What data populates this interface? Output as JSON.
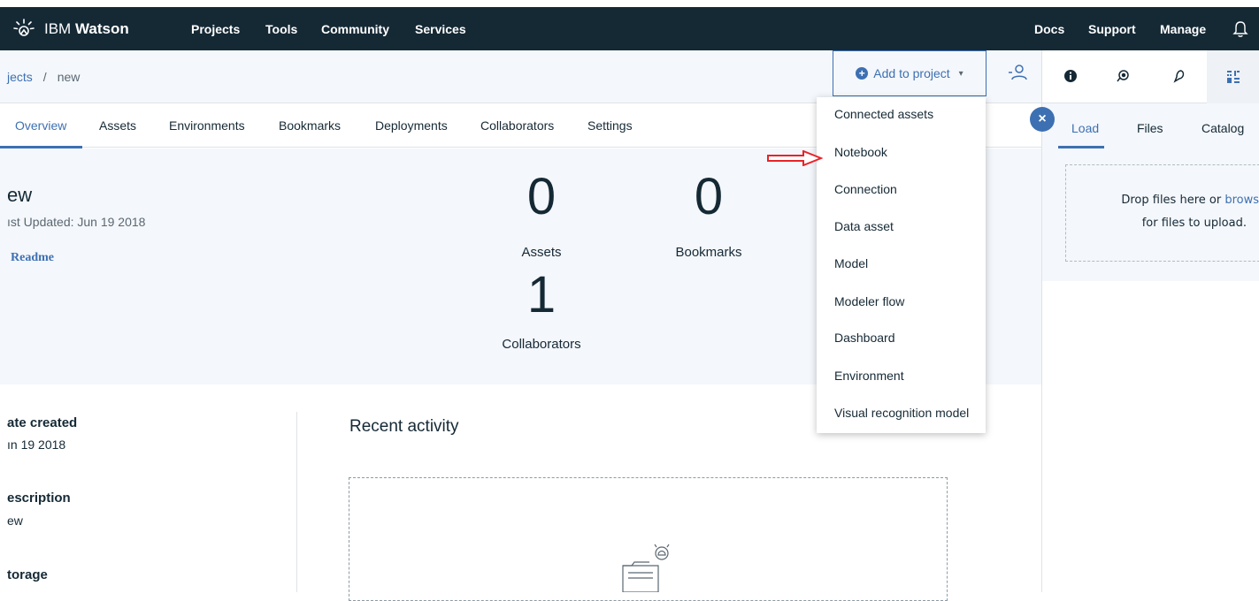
{
  "topbar": {
    "brand_light": "IBM",
    "brand_bold": "Watson",
    "nav": [
      "Projects",
      "Tools",
      "Community",
      "Services"
    ],
    "right_nav": [
      "Docs",
      "Support",
      "Manage"
    ]
  },
  "breadcrumb": {
    "parent": "jects",
    "separator": "/",
    "current": "new"
  },
  "add_button": {
    "label": "Add to project"
  },
  "tabs": [
    "Overview",
    "Assets",
    "Environments",
    "Bookmarks",
    "Deployments",
    "Collaborators",
    "Settings"
  ],
  "overview": {
    "name": "ew",
    "updated": "ıst Updated: Jun 19 2018",
    "readme": "Readme",
    "stats": [
      {
        "value": "0",
        "label": "Assets"
      },
      {
        "value": "0",
        "label": "Bookmarks"
      },
      {
        "value": "1",
        "label": "Collaborators"
      }
    ]
  },
  "meta": {
    "date_label": "ate created",
    "date_value": "ın 19 2018",
    "description_label": "escription",
    "description_value": "ew",
    "storage_label": "torage"
  },
  "recent_activity": {
    "title": "Recent activity"
  },
  "dropdown": {
    "items": [
      "Connected assets",
      "Notebook",
      "Connection",
      "Data asset",
      "Model",
      "Modeler flow",
      "Dashboard",
      "Environment",
      "Visual recognition model"
    ]
  },
  "right_panel": {
    "tabs": [
      "Load",
      "Files",
      "Catalog"
    ],
    "drop_text_1": "Drop files here or",
    "drop_link": "browse",
    "drop_text_2": "for files to upload."
  },
  "colors": {
    "topbar": "#152935",
    "accent": "#3d70b2",
    "arrow": "#e8232a"
  }
}
